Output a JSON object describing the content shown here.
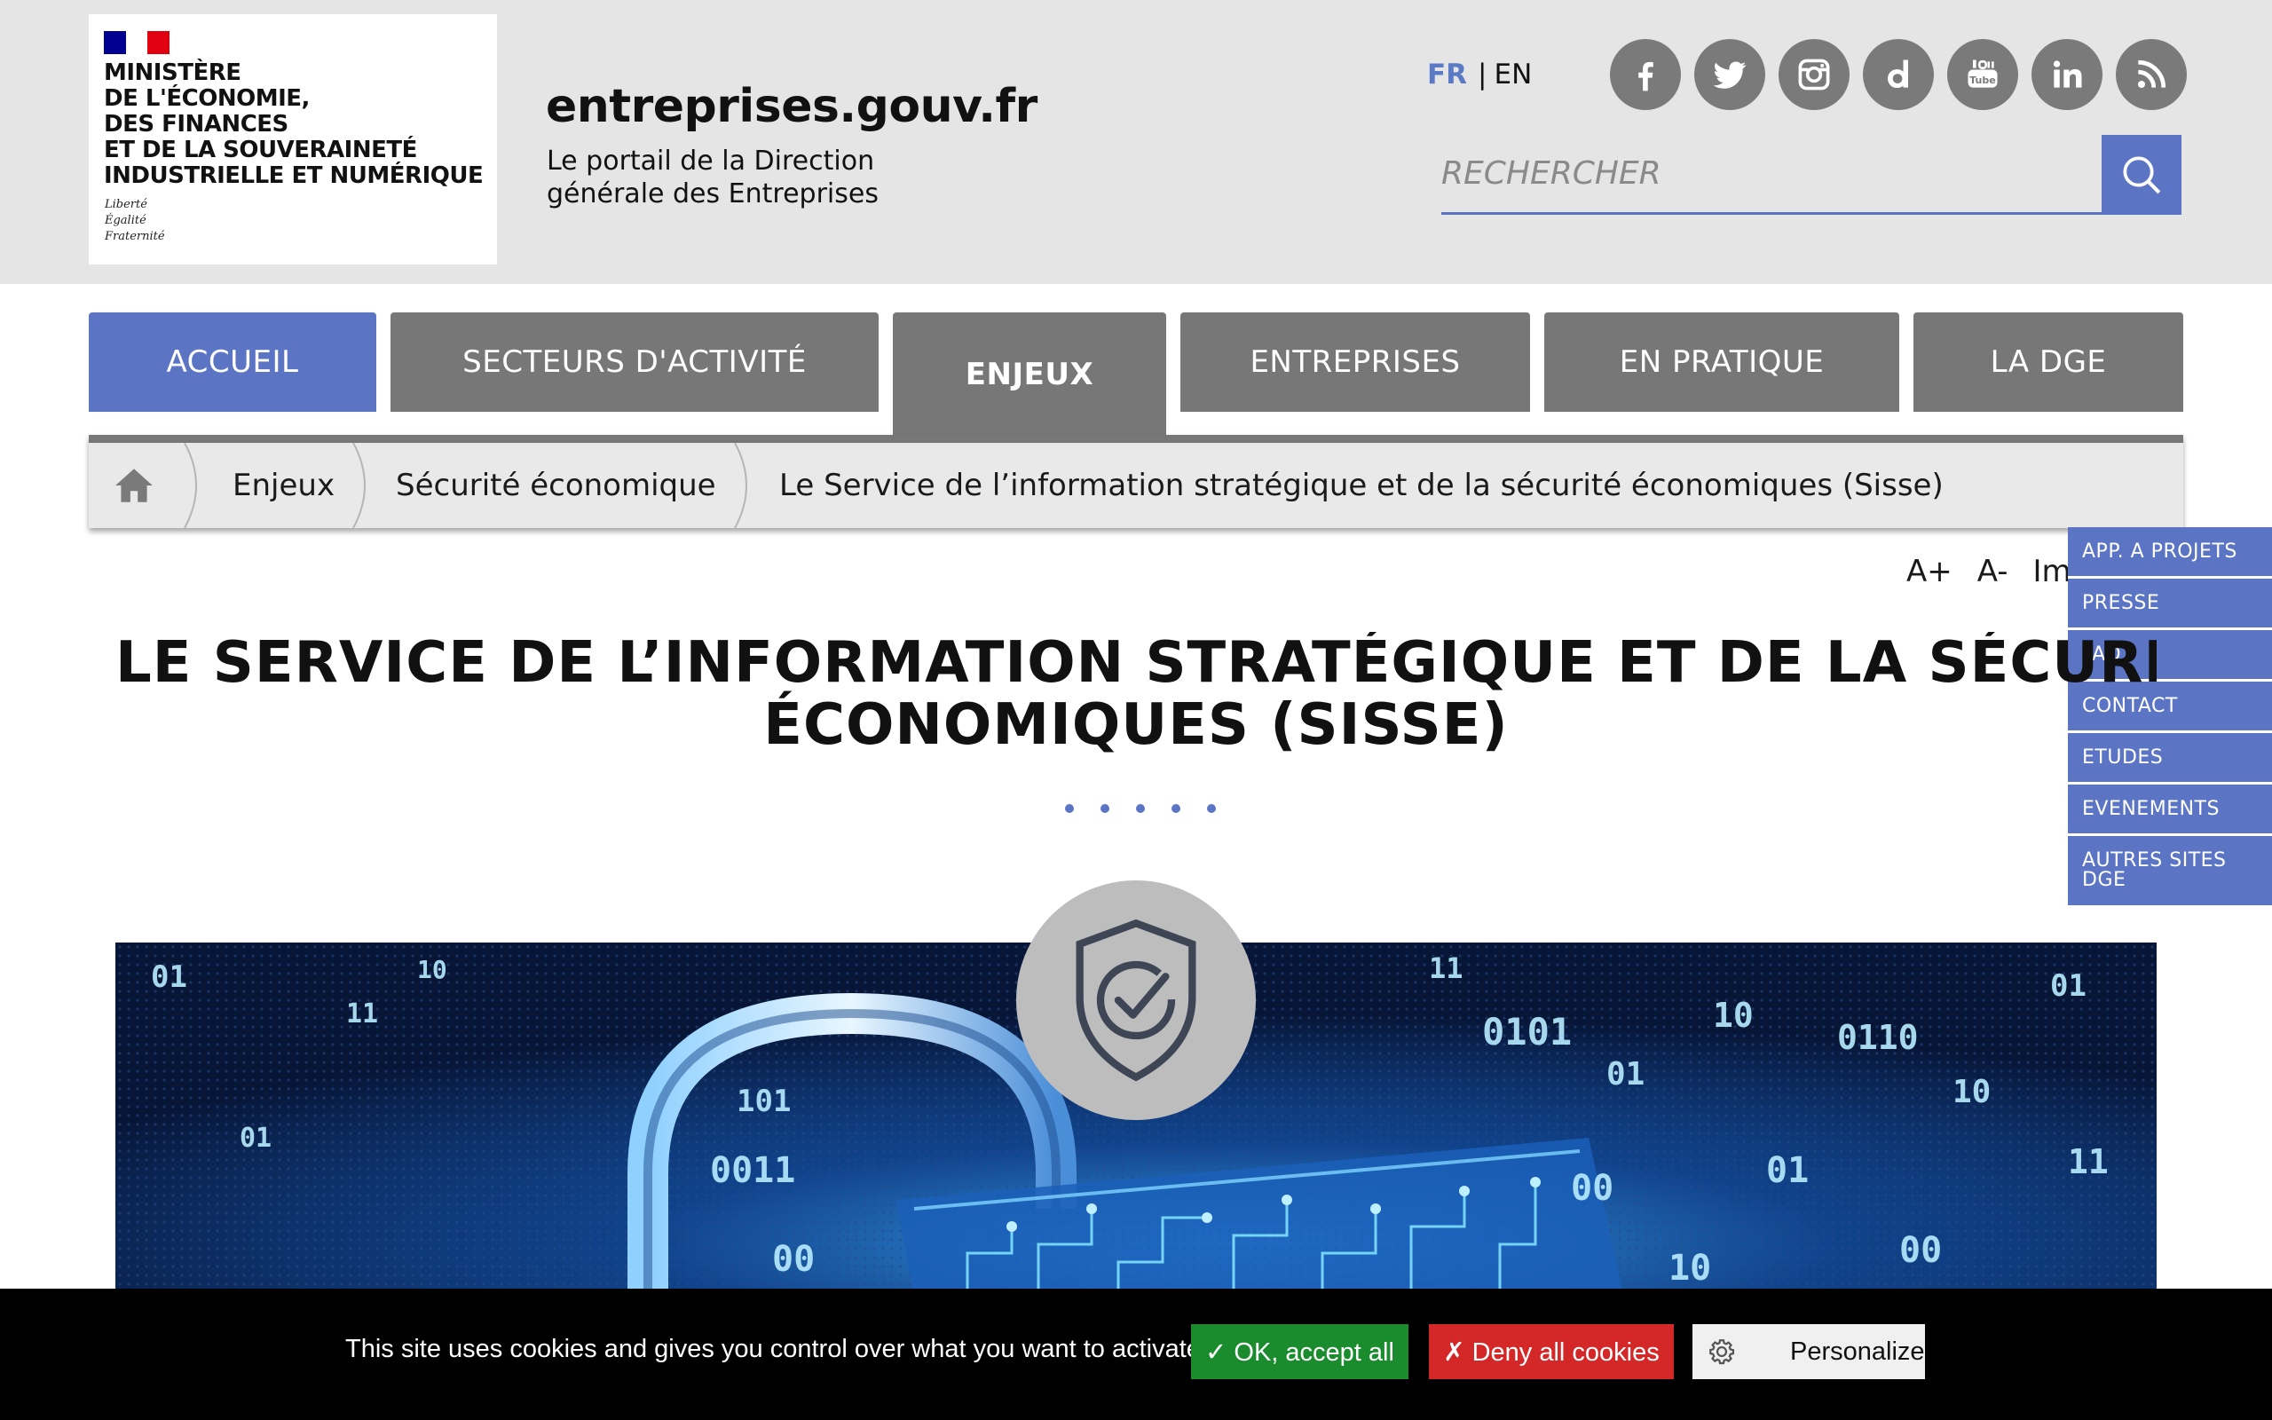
{
  "header": {
    "ministry_name": "Ministère\nde l'Économie,\ndes Finances\net de la Souveraineté\nindustrielle et numérique",
    "motto": "Liberté\nÉgalité\nFraternité",
    "site_title": "entreprises.gouv.fr",
    "site_subtitle": "Le portail de la Direction générale des Entreprises",
    "lang_fr": "FR",
    "lang_separator": "|",
    "lang_en": "EN",
    "search_placeholder": "RECHERCHER",
    "socials": [
      "facebook-icon",
      "twitter-icon",
      "instagram-icon",
      "dailymotion-icon",
      "youtube-icon",
      "linkedin-icon",
      "rss-icon"
    ]
  },
  "nav": {
    "items": [
      {
        "label": "ACCUEIL"
      },
      {
        "label": "SECTEURS D'ACTIVITÉ"
      },
      {
        "label": "ENJEUX"
      },
      {
        "label": "ENTREPRISES"
      },
      {
        "label": "EN PRATIQUE"
      },
      {
        "label": "LA DGE"
      }
    ]
  },
  "breadcrumb": {
    "items": [
      {
        "label": "Enjeux"
      },
      {
        "label": "Sécurité économique"
      },
      {
        "label": "Le Service de l’information stratégique et de la sécurité économiques (Sisse)"
      }
    ]
  },
  "font_tools": {
    "increase": "A+",
    "decrease": "A-",
    "print": "Imprimer"
  },
  "side_menu": {
    "items": [
      {
        "label": "APP. A PROJETS"
      },
      {
        "label": "PRESSE"
      },
      {
        "label": "FAQ"
      },
      {
        "label": "CONTACT"
      },
      {
        "label": "ETUDES"
      },
      {
        "label": "EVENEMENTS"
      },
      {
        "label": "AUTRES SITES DGE"
      }
    ]
  },
  "main": {
    "title_line1": "LE SERVICE DE L’INFORMATION STRATÉGIQUE ET DE LA SÉCURITÉ",
    "title_line2": "ÉCONOMIQUES (SISSE)",
    "hero_digits": [
      "01",
      "11",
      "10",
      "0011",
      "00",
      "101",
      "0101",
      "11",
      "01",
      "10",
      "00",
      "01",
      "0110",
      "10",
      "01",
      "11",
      "00",
      "10",
      "01",
      "00"
    ]
  },
  "cookie": {
    "text": "This site uses cookies and gives you control over what you want to activate",
    "ok_label": "✓ OK, accept all",
    "deny_label": "✗ Deny all cookies",
    "personalize_label": "Personalize"
  },
  "colors": {
    "accent_blue": "#5b75c4",
    "nav_gray": "#777777",
    "header_bg": "#e5e5e5",
    "ok_green": "#1b8c2e",
    "deny_red": "#d42828"
  }
}
